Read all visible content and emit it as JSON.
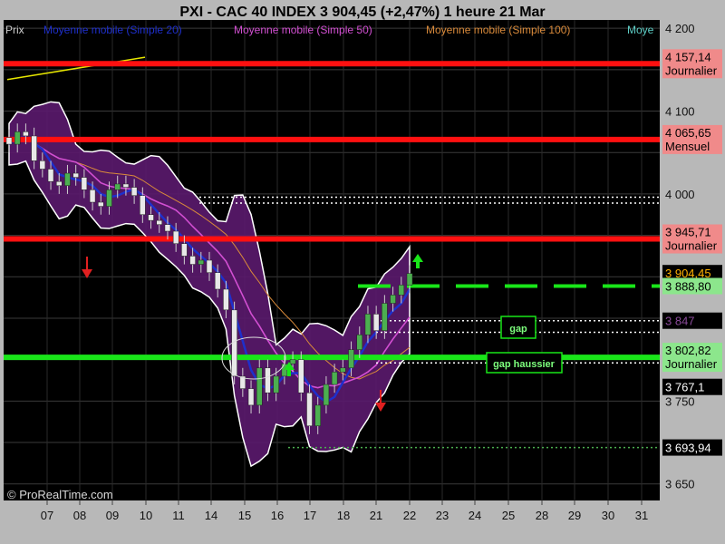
{
  "chart_data": {
    "type": "candlestick",
    "title": "PXI - CAC 40 INDEX     3 904,45 (+2,47%)     1 heure  21 Mar",
    "copyright": "© ProRealTime.com",
    "legend": [
      {
        "name": "Prix",
        "color": "#000000"
      },
      {
        "name": "Moyenne mobile (Simple 20)",
        "color": "#1e2fcc"
      },
      {
        "name": "Moyenne mobile (Simple 50)",
        "color": "#d24fd2"
      },
      {
        "name": "Moyenne mobile (Simple 100)",
        "color": "#d98a3a"
      },
      {
        "name": "Moye",
        "color": "#5fd0c8"
      }
    ],
    "ylim": [
      3630,
      4210
    ],
    "y_ticks": [
      {
        "value": 4200,
        "label": "4 200"
      },
      {
        "value": 4100,
        "label": "4 100"
      },
      {
        "value": 4000,
        "label": "4 000"
      },
      {
        "value": 3750,
        "label": "3 750"
      },
      {
        "value": 3650,
        "label": "3 650"
      }
    ],
    "x_labels": [
      "07",
      "08",
      "09",
      "10",
      "11",
      "14",
      "15",
      "16",
      "17",
      "18",
      "21",
      "22",
      "23",
      "24",
      "25",
      "28",
      "29",
      "30",
      "31"
    ],
    "price_levels": [
      {
        "value": 4157.14,
        "label": "4 157,14",
        "sublabel": "Journalier",
        "color": "#ff1010",
        "style": "thick",
        "bg": "#f08a8a"
      },
      {
        "value": 4065.65,
        "label": "4 065,65",
        "sublabel": "Mensuel",
        "color": "#ff1010",
        "style": "thick",
        "bg": "#f08a8a"
      },
      {
        "value": 3945.71,
        "label": "3 945,71",
        "sublabel": "Journalier",
        "color": "#ff1010",
        "style": "thick",
        "bg": "#f08a8a"
      },
      {
        "value": 3904.45,
        "label": "3 904,45",
        "sublabel": "",
        "color": "#ffb000",
        "style": "last",
        "bg": "#000000"
      },
      {
        "value": 3888.8,
        "label": "3 888,80",
        "sublabel": "",
        "color": "#19e619",
        "style": "dashed-thick",
        "bg": "#8ce68c"
      },
      {
        "value": 3847,
        "label": "3 847",
        "sublabel": "",
        "color": "#7a2f8a",
        "style": "dotted",
        "bg": "#000000"
      },
      {
        "value": 3802.82,
        "label": "3 802,82",
        "sublabel": "Journalier",
        "color": "#19e619",
        "style": "thick",
        "bg": "#8ce68c"
      },
      {
        "value": 3767.1,
        "label": "3 767,1",
        "sublabel": "",
        "color": "#ffffff",
        "style": "none",
        "bg": "#000000"
      },
      {
        "value": 3693.94,
        "label": "3 693,94",
        "sublabel": "",
        "color": "#4caf50",
        "style": "dotted",
        "bg": "#000000"
      }
    ],
    "annotations": [
      {
        "text": "gap",
        "color": "#7dff7d"
      },
      {
        "text": "gap haussier",
        "color": "#7dff7d"
      }
    ],
    "extra_dotted_levels": [
      3996,
      3989,
      3833,
      3796
    ],
    "candles_close_path": [
      [
        0,
        4060
      ],
      [
        1,
        4075
      ],
      [
        2,
        4070
      ],
      [
        3,
        4040
      ],
      [
        4,
        4030
      ],
      [
        5,
        4015
      ],
      [
        6,
        4010
      ],
      [
        7,
        4025
      ],
      [
        8,
        4020
      ],
      [
        9,
        4005
      ],
      [
        10,
        3990
      ],
      [
        11,
        3985
      ],
      [
        12,
        4005
      ],
      [
        13,
        4012
      ],
      [
        14,
        4008
      ],
      [
        15,
        3998
      ],
      [
        16,
        3975
      ],
      [
        17,
        3968
      ],
      [
        18,
        3963
      ],
      [
        19,
        3955
      ],
      [
        20,
        3940
      ],
      [
        21,
        3925
      ],
      [
        22,
        3915
      ],
      [
        23,
        3920
      ],
      [
        24,
        3905
      ],
      [
        25,
        3885
      ],
      [
        26,
        3860
      ],
      [
        27,
        3780
      ],
      [
        28,
        3765
      ],
      [
        29,
        3745
      ],
      [
        30,
        3790
      ],
      [
        31,
        3760
      ],
      [
        32,
        3780
      ],
      [
        33,
        3795
      ],
      [
        34,
        3800
      ],
      [
        35,
        3760
      ],
      [
        36,
        3720
      ],
      [
        37,
        3745
      ],
      [
        38,
        3770
      ],
      [
        39,
        3785
      ],
      [
        40,
        3790
      ],
      [
        41,
        3812
      ],
      [
        42,
        3830
      ],
      [
        43,
        3855
      ],
      [
        44,
        3835
      ],
      [
        45,
        3868
      ],
      [
        46,
        3878
      ],
      [
        47,
        3890
      ],
      [
        48,
        3904
      ]
    ]
  }
}
